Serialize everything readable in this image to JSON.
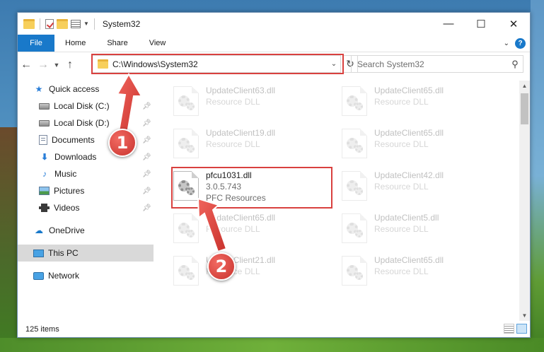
{
  "window": {
    "title": "System32",
    "controls": {
      "minimize": "—",
      "maximize": "☐",
      "close": "✕"
    }
  },
  "ribbon": {
    "tabs": [
      "File",
      "Home",
      "Share",
      "View"
    ]
  },
  "address": {
    "path": "C:\\Windows\\System32",
    "search_placeholder": "Search System32"
  },
  "sidebar": {
    "items": [
      {
        "label": "Quick access",
        "icon": "star-icon"
      },
      {
        "label": "Local Disk (C:)",
        "icon": "disk-icon",
        "pinned": true
      },
      {
        "label": "Local Disk (D:)",
        "icon": "disk-icon",
        "pinned": true
      },
      {
        "label": "Documents",
        "icon": "documents-icon",
        "pinned": true
      },
      {
        "label": "Downloads",
        "icon": "download-icon",
        "pinned": true
      },
      {
        "label": "Music",
        "icon": "music-icon",
        "pinned": true
      },
      {
        "label": "Pictures",
        "icon": "pictures-icon",
        "pinned": true
      },
      {
        "label": "Videos",
        "icon": "videos-icon",
        "pinned": true
      },
      {
        "label": "OneDrive",
        "icon": "cloud-icon"
      },
      {
        "label": "This PC",
        "icon": "computer-icon",
        "selected": true
      },
      {
        "label": "Network",
        "icon": "network-icon"
      }
    ]
  },
  "files": [
    {
      "name": "UpdateClient63.dll",
      "sub": "Resource DLL",
      "faded": true
    },
    {
      "name": "UpdateClient65.dll",
      "sub": "Resource DLL",
      "faded": true
    },
    {
      "name": "UpdateClient19.dll",
      "sub": "Resource DLL",
      "faded": true
    },
    {
      "name": "UpdateClient65.dll",
      "sub": "Resource DLL",
      "faded": true
    },
    {
      "name": "pfcu1031.dll",
      "version": "3.0.5.743",
      "sub": "PFC Resources",
      "faded": false
    },
    {
      "name": "UpdateClient42.dll",
      "sub": "Resource DLL",
      "faded": true
    },
    {
      "name": "UpdateClient65.dll",
      "sub": "Resource DLL",
      "faded": true
    },
    {
      "name": "UpdateClient5.dll",
      "sub": "Resource DLL",
      "faded": true
    },
    {
      "name": "UpdateClient21.dll",
      "sub": "Resource DLL",
      "faded": true
    },
    {
      "name": "UpdateClient65.dll",
      "sub": "Resource DLL",
      "faded": true
    }
  ],
  "status": {
    "item_count": "125 items"
  },
  "annotations": {
    "step1": "1",
    "step2": "2",
    "color": "#d9413f"
  }
}
